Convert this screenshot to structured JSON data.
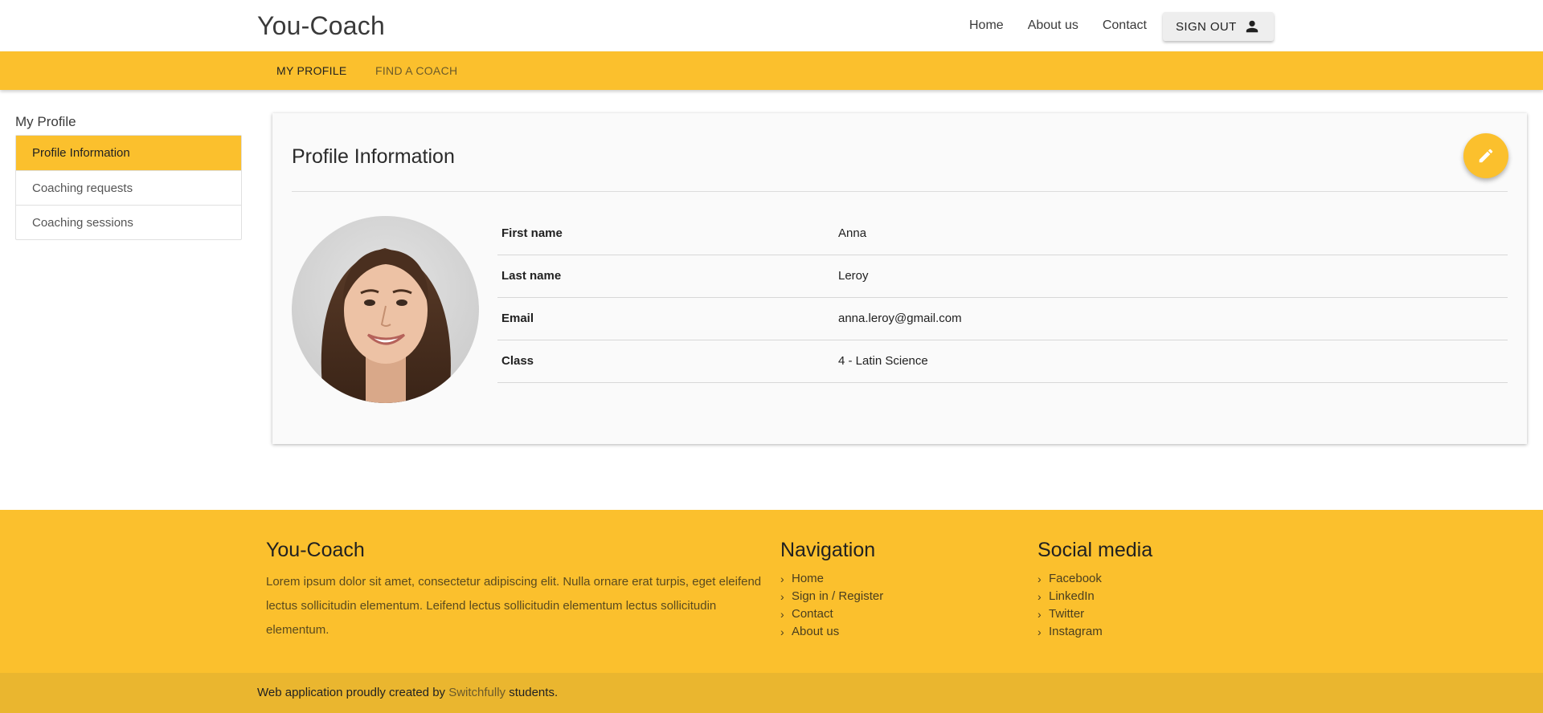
{
  "header": {
    "brand": "You-Coach",
    "nav": [
      {
        "label": "Home"
      },
      {
        "label": "About us"
      },
      {
        "label": "Contact"
      }
    ],
    "signout_label": "SIGN OUT"
  },
  "subnav": {
    "tabs": [
      {
        "label": "MY PROFILE",
        "active": true
      },
      {
        "label": "FIND A COACH",
        "active": false
      }
    ]
  },
  "sidebar": {
    "title": "My Profile",
    "items": [
      {
        "label": "Profile Information",
        "active": true
      },
      {
        "label": "Coaching requests",
        "active": false
      },
      {
        "label": "Coaching sessions",
        "active": false
      }
    ]
  },
  "profile": {
    "title": "Profile Information",
    "fields": [
      {
        "label": "First name",
        "value": "Anna"
      },
      {
        "label": "Last name",
        "value": "Leroy"
      },
      {
        "label": "Email",
        "value": "anna.leroy@gmail.com"
      },
      {
        "label": "Class",
        "value": "4 - Latin Science"
      }
    ]
  },
  "footer": {
    "brand": "You-Coach",
    "description": "Lorem ipsum dolor sit amet, consectetur adipiscing elit. Nulla ornare erat turpis, eget eleifend lectus sollicitudin elementum. Leifend lectus sollicitudin elementum lectus sollicitudin elementum.",
    "navigation_title": "Navigation",
    "navigation": [
      {
        "label": "Home"
      },
      {
        "label": "Sign in / Register"
      },
      {
        "label": "Contact"
      },
      {
        "label": "About us"
      }
    ],
    "social_title": "Social media",
    "social": [
      {
        "label": "Facebook"
      },
      {
        "label": "LinkedIn"
      },
      {
        "label": "Twitter"
      },
      {
        "label": "Instagram"
      }
    ],
    "credit_prefix": "Web application proudly created by",
    "credit_link": "Switchfully",
    "credit_suffix": "students."
  },
  "colors": {
    "accent": "#fbc02d",
    "bottom_bar": "#eab62f"
  },
  "icons": {
    "signout": "person-icon",
    "edit": "pencil-icon",
    "footer_link": "chevron-right-icon"
  }
}
